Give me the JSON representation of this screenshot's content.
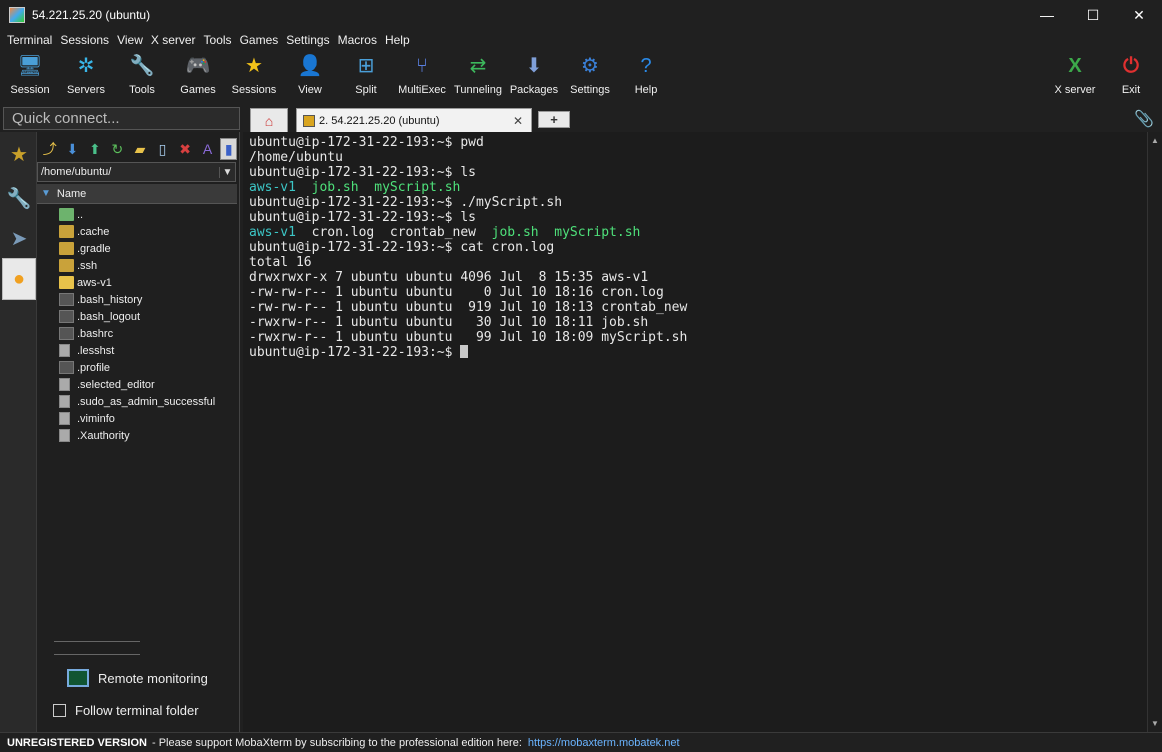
{
  "window": {
    "title": "54.221.25.20 (ubuntu)",
    "controls": {
      "minimize": "—",
      "maximize": "☐",
      "close": "✕"
    }
  },
  "menu": [
    "Terminal",
    "Sessions",
    "View",
    "X server",
    "Tools",
    "Games",
    "Settings",
    "Macros",
    "Help"
  ],
  "toolbar": {
    "left": [
      {
        "label": "Session",
        "icon": "session-icon",
        "glyph": "🖥",
        "color": "#4a9fd8"
      },
      {
        "label": "Servers",
        "icon": "servers-icon",
        "glyph": "✲",
        "color": "#39b6e8"
      },
      {
        "label": "Tools",
        "icon": "tools-icon",
        "glyph": "🔧",
        "color": "#e04040"
      },
      {
        "label": "Games",
        "icon": "games-icon",
        "glyph": "🎮",
        "color": "#dddddd"
      },
      {
        "label": "Sessions",
        "icon": "star-icon",
        "glyph": "★",
        "color": "#f2c21a"
      },
      {
        "label": "View",
        "icon": "view-icon",
        "glyph": "👤",
        "color": "#58b858"
      },
      {
        "label": "Split",
        "icon": "split-icon",
        "glyph": "⊞",
        "color": "#4a9fd8"
      },
      {
        "label": "MultiExec",
        "icon": "multiexec-icon",
        "glyph": "⑂",
        "color": "#5a7fe0"
      },
      {
        "label": "Tunneling",
        "icon": "tunneling-icon",
        "glyph": "⇄",
        "color": "#3cb85c"
      },
      {
        "label": "Packages",
        "icon": "packages-icon",
        "glyph": "⬇",
        "color": "#7f9fd8"
      },
      {
        "label": "Settings",
        "icon": "gear-icon",
        "glyph": "⚙",
        "color": "#3a80d8"
      },
      {
        "label": "Help",
        "icon": "help-icon",
        "glyph": "?",
        "color": "#2a8ae8"
      }
    ],
    "right": [
      {
        "label": "X server",
        "icon": "x-server-icon",
        "glyph": "X",
        "color": "#3ca84a"
      },
      {
        "label": "Exit",
        "icon": "power-icon",
        "glyph": "⏻",
        "color": "#e03030"
      }
    ]
  },
  "quick_connect": {
    "placeholder": "Quick connect..."
  },
  "sidebar_tabs": [
    {
      "name": "star-icon",
      "glyph": "★",
      "color": "#c8a02a"
    },
    {
      "name": "tools-icon",
      "glyph": "🔧",
      "color": "#a84040"
    },
    {
      "name": "paper-plane-icon",
      "glyph": "➤",
      "color": "#7a9ab8"
    },
    {
      "name": "sftp-globe-icon",
      "glyph": "●",
      "color": "#f0a020"
    }
  ],
  "sftp": {
    "tools": [
      {
        "name": "parent-folder-icon",
        "glyph": "⤴",
        "color": "#e8c24a"
      },
      {
        "name": "download-icon",
        "glyph": "⬇",
        "color": "#4a8fd8"
      },
      {
        "name": "upload-icon",
        "glyph": "⬆",
        "color": "#4ac08a"
      },
      {
        "name": "refresh-icon",
        "glyph": "↻",
        "color": "#5cc05c"
      },
      {
        "name": "new-folder-icon",
        "glyph": "▰",
        "color": "#e8c24a"
      },
      {
        "name": "new-file-icon",
        "glyph": "▯",
        "color": "#aad0f0"
      },
      {
        "name": "delete-icon",
        "glyph": "✖",
        "color": "#d84040"
      },
      {
        "name": "rename-icon",
        "glyph": "A",
        "color": "#8a6ad8"
      },
      {
        "name": "sftp-options-icon",
        "glyph": "▮",
        "color": "#3a60c8"
      }
    ],
    "path": "/home/ubuntu/",
    "column": "Name",
    "files": [
      {
        "name": "..",
        "type": "up"
      },
      {
        "name": ".cache",
        "type": "folder"
      },
      {
        "name": ".gradle",
        "type": "folder"
      },
      {
        "name": ".ssh",
        "type": "folder"
      },
      {
        "name": "aws-v1",
        "type": "folder open"
      },
      {
        "name": ".bash_history",
        "type": "file-dark"
      },
      {
        "name": ".bash_logout",
        "type": "file-dark"
      },
      {
        "name": ".bashrc",
        "type": "file-dark"
      },
      {
        "name": ".lesshst",
        "type": "file-doc"
      },
      {
        "name": ".profile",
        "type": "file-dark"
      },
      {
        "name": ".selected_editor",
        "type": "file-doc"
      },
      {
        "name": ".sudo_as_admin_successful",
        "type": "file-doc"
      },
      {
        "name": ".viminfo",
        "type": "file-doc"
      },
      {
        "name": ".Xauthority",
        "type": "file-doc"
      }
    ],
    "remote_monitoring": "Remote monitoring",
    "follow_folder": "Follow terminal folder",
    "follow_checked": false
  },
  "tabs": {
    "home": "⌂",
    "session": "2. 54.221.25.20 (ubuntu)",
    "close": "✕",
    "new": "+",
    "attach": "📎"
  },
  "terminal": {
    "lines": [
      [
        {
          "t": "ubuntu@ip-172-31-22-193:~$ pwd"
        }
      ],
      [
        {
          "t": "/home/ubuntu"
        }
      ],
      [
        {
          "t": "ubuntu@ip-172-31-22-193:~$ ls"
        }
      ],
      [
        {
          "t": "aws-v1",
          "c": "c-cyan"
        },
        {
          "t": "  "
        },
        {
          "t": "job.sh",
          "c": "c-green"
        },
        {
          "t": "  "
        },
        {
          "t": "myScript.sh",
          "c": "c-green"
        }
      ],
      [
        {
          "t": "ubuntu@ip-172-31-22-193:~$ ./myScript.sh"
        }
      ],
      [
        {
          "t": "ubuntu@ip-172-31-22-193:~$ ls"
        }
      ],
      [
        {
          "t": "aws-v1",
          "c": "c-cyan"
        },
        {
          "t": "  cron.log  crontab_new  "
        },
        {
          "t": "job.sh",
          "c": "c-green"
        },
        {
          "t": "  "
        },
        {
          "t": "myScript.sh",
          "c": "c-green"
        }
      ],
      [
        {
          "t": "ubuntu@ip-172-31-22-193:~$ cat cron.log"
        }
      ],
      [
        {
          "t": "total 16"
        }
      ],
      [
        {
          "t": "drwxrwxr-x 7 ubuntu ubuntu 4096 Jul  8 15:35 aws-v1"
        }
      ],
      [
        {
          "t": "-rw-rw-r-- 1 ubuntu ubuntu    0 Jul 10 18:16 cron.log"
        }
      ],
      [
        {
          "t": "-rw-rw-r-- 1 ubuntu ubuntu  919 Jul 10 18:13 crontab_new"
        }
      ],
      [
        {
          "t": "-rwxrw-r-- 1 ubuntu ubuntu   30 Jul 10 18:11 job.sh"
        }
      ],
      [
        {
          "t": "-rwxrw-r-- 1 ubuntu ubuntu   99 Jul 10 18:09 myScript.sh"
        }
      ],
      [
        {
          "t": "ubuntu@ip-172-31-22-193:~$ "
        },
        {
          "cursor": true
        }
      ]
    ]
  },
  "status": {
    "bold": "UNREGISTERED VERSION",
    "text": "-  Please support MobaXterm by subscribing to the professional edition here:",
    "link": "https://mobaxterm.mobatek.net"
  }
}
